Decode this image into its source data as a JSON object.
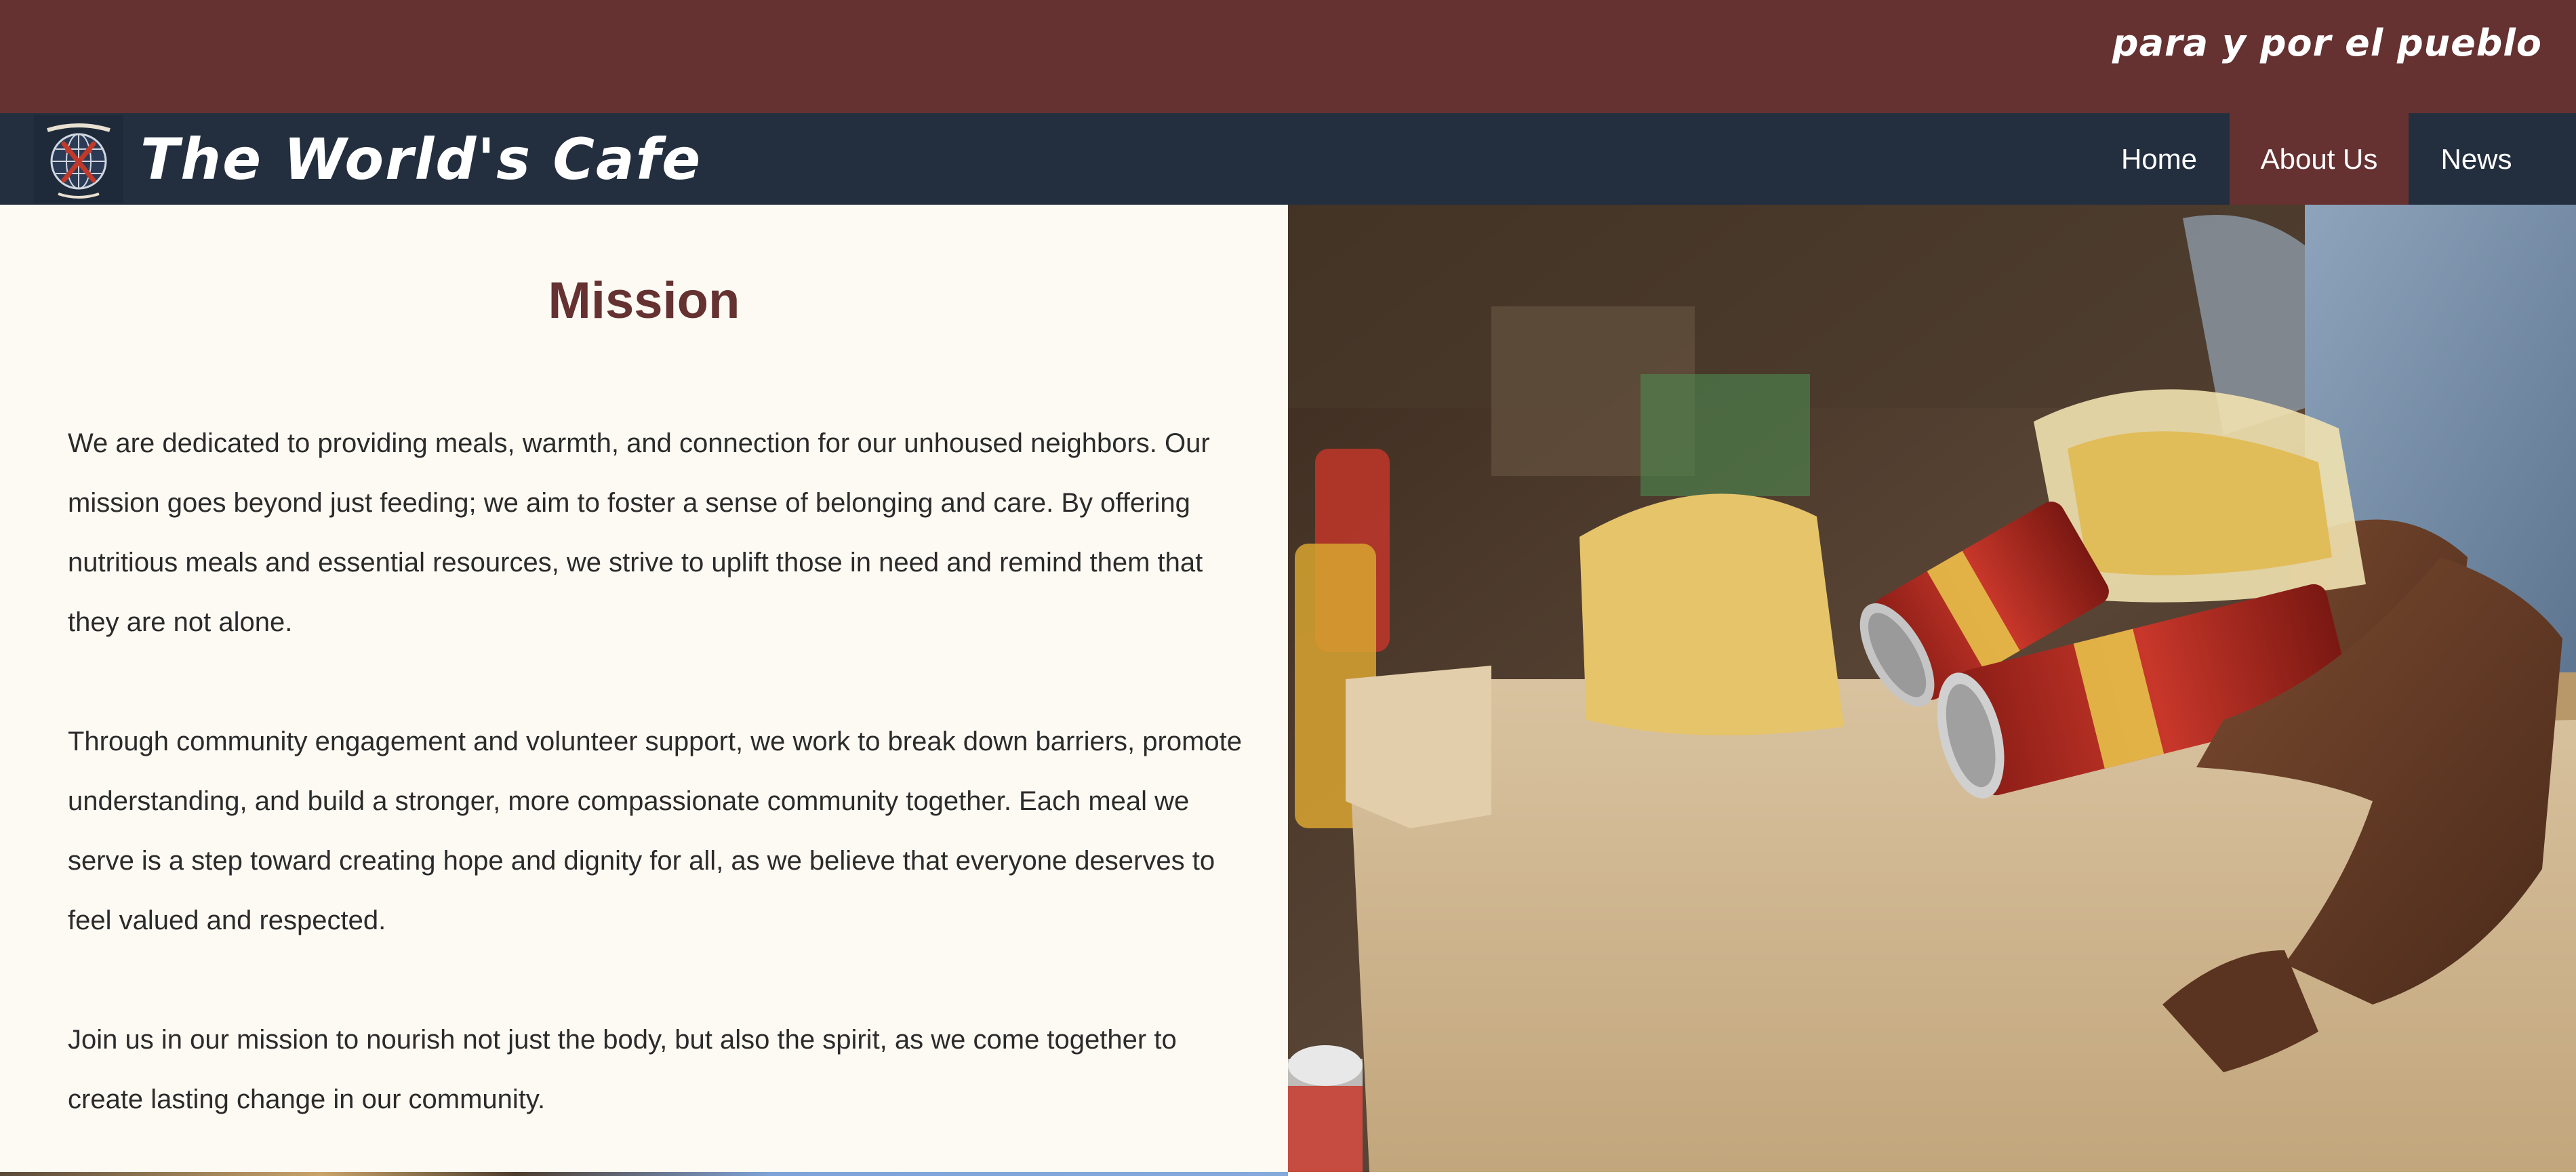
{
  "header": {
    "tagline": "para y por el pueblo"
  },
  "navbar": {
    "brand": "The World's Cafe",
    "logo_icon": "globe-logo-icon",
    "items": [
      {
        "label": "Home",
        "active": false
      },
      {
        "label": "About Us",
        "active": true
      },
      {
        "label": "News",
        "active": false
      }
    ]
  },
  "main": {
    "title": "Mission",
    "paragraphs": [
      "We are dedicated to providing meals, warmth, and connection for our unhoused neighbors. Our mission goes beyond just feeding; we aim to foster a sense of belonging and care. By offering nutritious meals and essential resources, we strive to uplift those in need and remind them that they are not alone.",
      "Through community engagement and volunteer support, we work to break down barriers, promote understanding, and build a stronger, more compassionate community together. Each meal we serve is a step toward creating hope and dignity for all, as we believe that everyone deserves to feel valued and respected.",
      "Join us in our mission to nourish not just the body, but also the spirit, as we come together to create lasting change in our community."
    ]
  },
  "colors": {
    "brand": "#653131",
    "nav_bg": "#232f3e",
    "page_bg": "#fcfaf3"
  }
}
